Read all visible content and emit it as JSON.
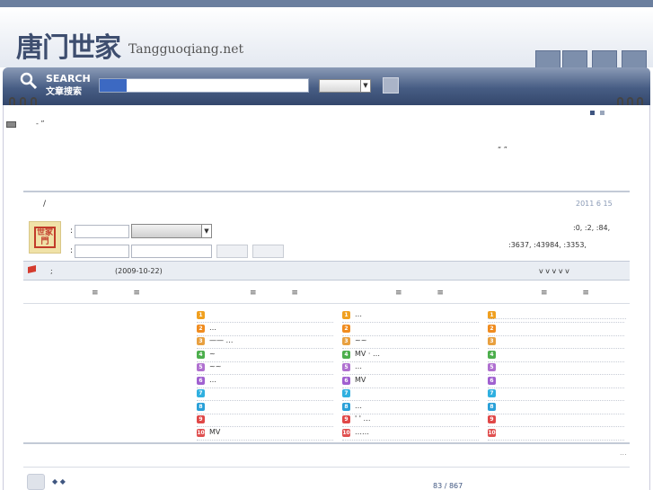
{
  "header": {
    "logo_cn": "唐门世家",
    "logo_en": "Tangguoqiang.net"
  },
  "search": {
    "label_en": "SEARCH",
    "label_cn": "文章搜索",
    "input_value": "",
    "select_value": ""
  },
  "page": {
    "top_marks": "- ”",
    "quote_marks": "“ ”",
    "slash": "/",
    "date": "2011 6 15"
  },
  "user": {
    "avatar_text": "世家門",
    "colon1": ":",
    "colon2": ":"
  },
  "stats": {
    "line1": ":0,  :2,  :84,",
    "line2": ":3637,  :43984,  :3353,"
  },
  "infobar": {
    "colon": ";",
    "date": "(2009-10-22)",
    "arrows": "v   v   v   v   v"
  },
  "columns": {
    "heads": [
      "≡ ≡",
      "≡ ≡",
      "≡ ≡",
      "≡ ≡"
    ]
  },
  "list_col2": [
    "",
    "…",
    "—— …",
    "~",
    "~~",
    "…",
    "",
    "",
    "",
    "MV"
  ],
  "list_col3": [
    "…",
    "",
    "~~",
    "MV  · …",
    "…",
    "MV",
    "",
    "…",
    "'  ' …",
    "……"
  ],
  "list_col4": [
    "",
    "",
    "",
    "",
    "",
    "",
    "",
    "",
    "",
    ""
  ],
  "list_colors": [
    "#f0a020",
    "#f08c20",
    "#e8a040",
    "#4cae4c",
    "#b070d0",
    "#a060d0",
    "#30b0e0",
    "#2aa0d8",
    "#e04848",
    "#e05050"
  ],
  "footer": {
    "dots": "...",
    "diamonds": "◆  ◆",
    "pages": "83 / 867"
  }
}
